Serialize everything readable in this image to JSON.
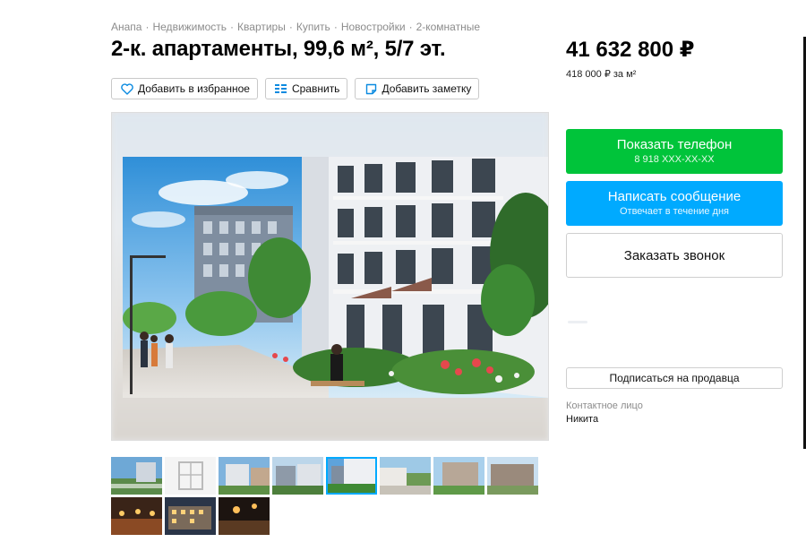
{
  "breadcrumbs": [
    "Анапа",
    "Недвижимость",
    "Квартиры",
    "Купить",
    "Новостройки",
    "2-комнатные"
  ],
  "breadcrumb_separator": "·",
  "listing": {
    "title": "2-к. апартаменты, 99,6 м², 5/7 эт.",
    "price": "41 632 800 ₽",
    "price_per_sqm": "418 000 ₽ за м²"
  },
  "actions": {
    "favorite": "Добавить в избранное",
    "compare": "Сравнить",
    "note": "Добавить заметку"
  },
  "contact_buttons": {
    "phone_label": "Показать телефон",
    "phone_number": "8 918 XXX-XX-XX",
    "message_label": "Написать сообщение",
    "message_sub": "Отвечает в течение дня",
    "callback_label": "Заказать звонок",
    "subscribe_label": "Подписаться на продавца"
  },
  "seller": {
    "contact_label": "Контактное лицо",
    "name": "Никита"
  },
  "gallery": {
    "thumbnails_row1": [
      "exterior-street",
      "floor-plan",
      "courtyard-view",
      "aerial-view",
      "facade-active",
      "park-view",
      "block-view",
      "complex-view"
    ],
    "thumbnails_row2": [
      "night-alley",
      "night-facade",
      "night-interior"
    ],
    "active_index": 4
  },
  "colors": {
    "phone_button": "#00c43a",
    "message_button": "#00aaff",
    "active_thumb_outline": "#00aaff"
  }
}
